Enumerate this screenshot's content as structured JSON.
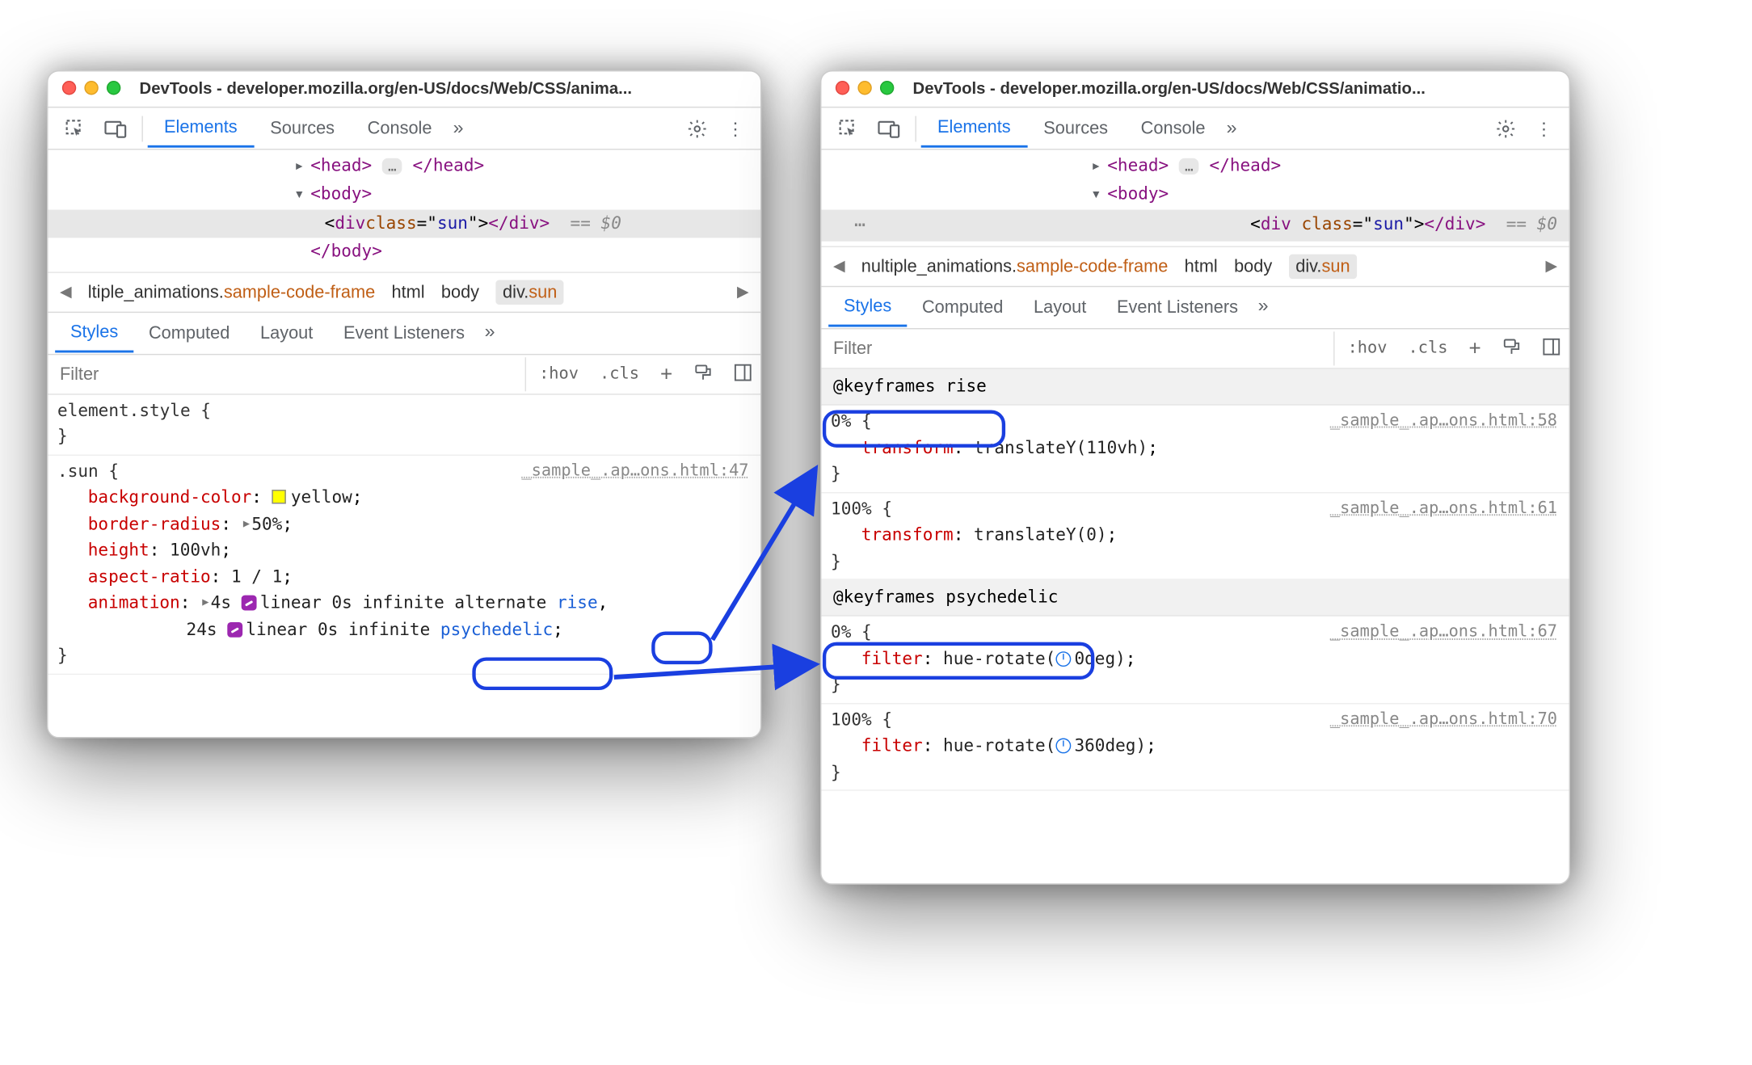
{
  "windows": {
    "left": {
      "title": "DevTools - developer.mozilla.org/en-US/docs/Web/CSS/anima..."
    },
    "right": {
      "title": "DevTools - developer.mozilla.org/en-US/docs/Web/CSS/animatio..."
    }
  },
  "main_tabs": {
    "elements": "Elements",
    "sources": "Sources",
    "console": "Console",
    "more": "»"
  },
  "dom": {
    "head_open": "<head>",
    "head_ell": "…",
    "head_close": "</head>",
    "body_open": "<body>",
    "body_close": "</body>",
    "div_open_tag": "div",
    "div_attr_name": "class",
    "div_attr_val": "sun",
    "div_close": "</div>",
    "eq": "== ",
    "dol": "$0"
  },
  "breadcrumbs": {
    "left_first_pre": "ltiple_animations.",
    "left_first_orange": "sample-code-frame",
    "right_first_pre": "nultiple_animations.",
    "right_first_orange": "sample-code-frame",
    "html": "html",
    "body": "body",
    "divsun_pre": "div.",
    "divsun_orange": "sun"
  },
  "panel_tabs": {
    "styles": "Styles",
    "computed": "Computed",
    "layout": "Layout",
    "listeners": "Event Listeners",
    "more": "»"
  },
  "filter": {
    "placeholder": "Filter",
    "hov": ":hov",
    "cls": ".cls"
  },
  "styles_left": {
    "element_style": "element.style {",
    "sun_sel": ".sun {",
    "sun_src": "_sample_.ap…ons.html:47",
    "bg": {
      "n": "background-color",
      "v": "yellow"
    },
    "br": {
      "n": "border-radius",
      "v": "50%"
    },
    "h": {
      "n": "height",
      "v": "100vh"
    },
    "ar": {
      "n": "aspect-ratio",
      "v": "1 / 1"
    },
    "anim": {
      "n": "animation",
      "l1_a": "4s ",
      "l1_b": "linear 0s infinite alternate ",
      "l1_link": "rise",
      "l2_a": "24s ",
      "l2_b": "linear 0s infinite ",
      "l2_link": "psychedelic"
    },
    "brace_close": "}"
  },
  "styles_right": {
    "kf_rise_hdr": "@keyframes rise",
    "kf_psy_hdr": "@keyframes psychedelic",
    "pct0": "0% {",
    "pct100": "100% {",
    "brace": "}",
    "rise0": {
      "src": "_sample_.ap…ons.html:58",
      "n": "transform",
      "v": "translateY(110vh)"
    },
    "rise100": {
      "src": "_sample_.ap…ons.html:61",
      "n": "transform",
      "v": "translateY(0)"
    },
    "psy0": {
      "src": "_sample_.ap…ons.html:67",
      "n": "filter",
      "fn": "hue-rotate(",
      "deg": "0deg",
      "cp": ")"
    },
    "psy100": {
      "src": "_sample_.ap…ons.html:70",
      "n": "filter",
      "fn": "hue-rotate(",
      "deg": "360deg",
      "cp": ")"
    }
  }
}
